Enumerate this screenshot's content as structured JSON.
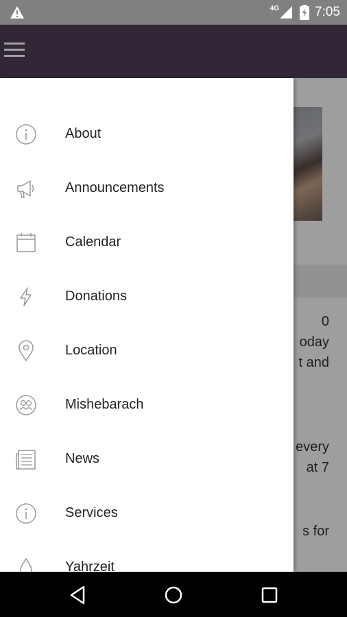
{
  "status_bar": {
    "network": "4G",
    "time": "7:05",
    "icons": [
      "warning-icon",
      "signal-icon",
      "battery-charging-icon"
    ]
  },
  "app_bar": {
    "menu_icon": "hamburger-menu-icon",
    "color": "#4f3f5a"
  },
  "background_text": [
    "0",
    "oday",
    "t and",
    "every",
    "at 7",
    "s for"
  ],
  "drawer": {
    "items": [
      {
        "label": "About",
        "icon": "info-icon"
      },
      {
        "label": "Announcements",
        "icon": "megaphone-icon"
      },
      {
        "label": "Calendar",
        "icon": "calendar-icon"
      },
      {
        "label": "Donations",
        "icon": "lightning-icon"
      },
      {
        "label": "Location",
        "icon": "map-pin-icon"
      },
      {
        "label": "Mishebarach",
        "icon": "people-circle-icon"
      },
      {
        "label": "News",
        "icon": "newspaper-icon"
      },
      {
        "label": "Services",
        "icon": "info-icon"
      },
      {
        "label": "Yahrzeit",
        "icon": "flame-icon"
      }
    ]
  },
  "nav_bar": {
    "back": "back-icon",
    "home": "home-icon",
    "recents": "recents-icon"
  }
}
